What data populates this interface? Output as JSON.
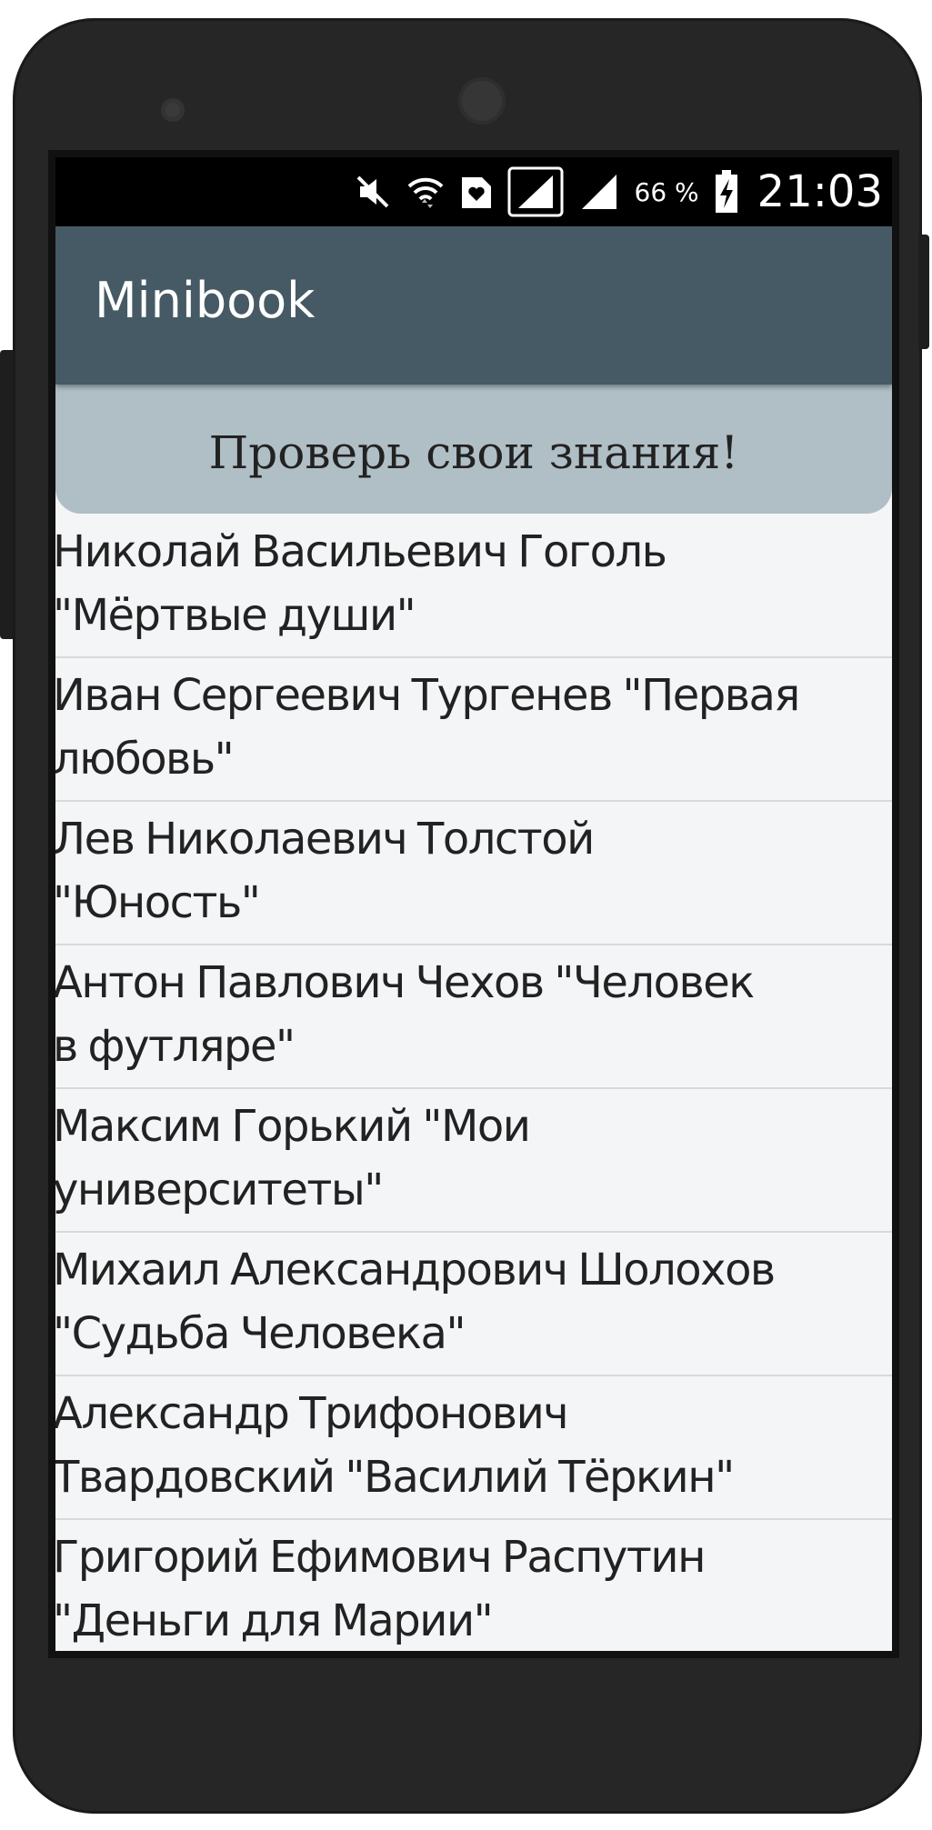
{
  "status_bar": {
    "battery_percent": "66 %",
    "time": "21:03",
    "icons": [
      "mute-icon",
      "wifi-icon",
      "heart-notification-icon",
      "signal-icon",
      "signal-icon",
      "battery-charging-icon"
    ]
  },
  "app_bar": {
    "title": "Minibook",
    "color": "#455a64"
  },
  "quiz_banner": {
    "label": "Проверь свои знания!",
    "color": "#b0bec5"
  },
  "books": [
    {
      "line1": "Николай Васильевич Гоголь",
      "line2": "\"Мёртвые души\""
    },
    {
      "line1": "Иван Сергеевич Тургенев \"Первая",
      "line2": "любовь\""
    },
    {
      "line1": "Лев Николаевич Толстой",
      "line2": "\"Юность\""
    },
    {
      "line1": "Антон Павлович Чехов \"Человек",
      "line2": "в футляре\""
    },
    {
      "line1": "Максим Горький \"Мои",
      "line2": "университеты\""
    },
    {
      "line1": "Михаил Александрович Шолохов",
      "line2": "\"Судьба Человека\""
    },
    {
      "line1": "Александр Трифонович",
      "line2": "Твардовский \"Василий Тёркин\""
    },
    {
      "line1": "Григорий Ефимович Распутин",
      "line2": "\"Деньги для Марии\""
    }
  ]
}
